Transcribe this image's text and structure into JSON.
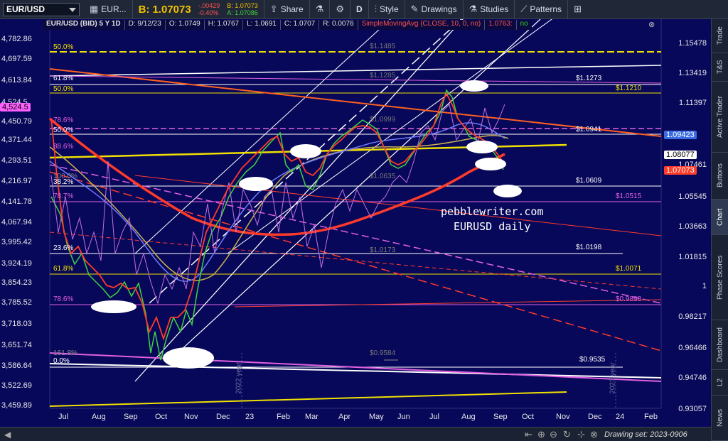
{
  "toolbar": {
    "symbol": "EUR/USD",
    "symbol_name": "EUR...",
    "bid_label": "B:",
    "bid_value": "1.07073",
    "change_abs": "-.00429",
    "change_pct": "-0.40%",
    "bid2": "B: 1.07073",
    "ask2": "A: 1.07086",
    "share_label": "Share",
    "period_label": "D",
    "style_label": "Style",
    "drawings_label": "Drawings",
    "studies_label": "Studies",
    "patterns_label": "Patterns"
  },
  "infobar": {
    "title": "EUR/USD (BID) 5 Y 1D",
    "date": "D: 9/12/23",
    "open": "O: 1.0749",
    "high": "H: 1.0767",
    "low": "L: 1.0691",
    "close": "C: 1.0707",
    "range": "R: 0.0076",
    "study": "SimpleMovingAvg (CLOSE, 10, 0, no)",
    "study_value": "1.0763:",
    "no": "no"
  },
  "left_axis": [
    "4,782.86",
    "4,697.59",
    "4,613.84",
    "4,524.5",
    "4,450.79",
    "4,371.44",
    "4,293.51",
    "4,216.97",
    "4,141.78",
    "4,067.94",
    "3,995.42",
    "3,924.19",
    "3,854.23",
    "3,785.52",
    "3,718.03",
    "3,651.74",
    "3,586.64",
    "3,522.69",
    "3,459.89"
  ],
  "right_axis": [
    "1.15478",
    "1.13419",
    "1.11397",
    "1.09423",
    "1.08077",
    "1.07461",
    "1.07073",
    "1.05545",
    "1.03663",
    "1.01815",
    "1",
    "0.98217",
    "0.96466",
    "0.94746",
    "0.93057"
  ],
  "x_axis": [
    "Jul",
    "Aug",
    "Sep",
    "Oct",
    "Nov",
    "Dec",
    "23",
    "Feb",
    "Mar",
    "Apr",
    "May",
    "Jun",
    "Jul",
    "Aug",
    "Sep",
    "Oct",
    "Nov",
    "Dec",
    "24",
    "Feb"
  ],
  "fib_left": [
    "50.0%",
    "61.8%",
    "50.0%",
    "78.6%",
    "50.0%",
    "88.6%",
    "100.0%",
    "38.2%",
    "78.7%",
    "23.6%",
    "61.8%",
    "78.6%",
    "161.8%",
    "0.0%"
  ],
  "level_labels": [
    "$1.1485",
    "$1.1285",
    "$1.1273",
    "$1.1210",
    "$1.0999",
    "$1.0941",
    "$1.0635",
    "$1.0609",
    "$1.0515",
    "$1.0173",
    "$1.0198",
    "$1.0071",
    "$0.9898",
    "$0.9584",
    "$0.9535"
  ],
  "watermark": [
    "pebblewriter.com",
    "EURUSD daily"
  ],
  "vertical_labels": [
    "2022 year",
    "2023 year"
  ],
  "status": {
    "drawing_set": "Drawing set: 2023-0906"
  },
  "rail_tabs": [
    "Trade",
    "T&S",
    "Active Trader",
    "Buttons",
    "Chart",
    "Phase Scores",
    "Dashboard",
    "L2",
    "News"
  ],
  "colors": {
    "chart_bg": "#08085a",
    "accent_yellow": "#f0e000",
    "red": "#ff3b2a",
    "magenta": "#e060e0"
  }
}
